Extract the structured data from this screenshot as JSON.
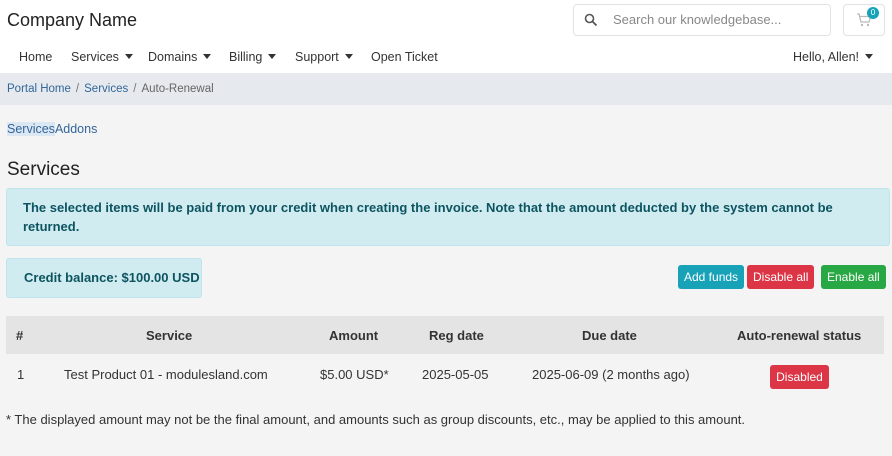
{
  "header": {
    "brand": "Company Name",
    "search_placeholder": "Search our knowledgebase...",
    "cart_count": "0"
  },
  "nav": {
    "home": "Home",
    "services": "Services",
    "domains": "Domains",
    "billing": "Billing",
    "support": "Support",
    "open_ticket": "Open Ticket",
    "user": "Hello, Allen!"
  },
  "breadcrumb": {
    "portal_home": "Portal Home",
    "separator": "/",
    "services": "Services",
    "current": "Auto-Renewal"
  },
  "subtabs": {
    "services": "Services",
    "addons": "Addons"
  },
  "main": {
    "title": "Services",
    "alert": "The selected items will be paid from your credit when creating the invoice. Note that the amount deducted by the system cannot be returned.",
    "credit_balance": "Credit balance: $100.00 USD",
    "buttons": {
      "add_funds": "Add funds",
      "disable_all": "Disable all",
      "enable_all": "Enable all"
    },
    "table": {
      "headers": {
        "num": "#",
        "service": "Service",
        "amount": "Amount",
        "reg_date": "Reg date",
        "due_date": "Due date",
        "status": "Auto-renewal status"
      },
      "rows": [
        {
          "num": "1",
          "service": "Test Product 01 - modulesland.com",
          "amount": "$5.00 USD*",
          "reg_date": "2025-05-05",
          "due_date": "2025-06-09 (2 months ago)",
          "status": "Disabled"
        }
      ]
    },
    "note": "* The displayed amount may not be the final amount, and amounts such as group discounts, etc., may be applied to this amount."
  },
  "colors": {
    "info_bg": "#d1ecf1",
    "info_text": "#0c5460",
    "danger": "#dc3545",
    "success": "#28a745",
    "teal": "#17a2b8",
    "link": "#336699"
  }
}
